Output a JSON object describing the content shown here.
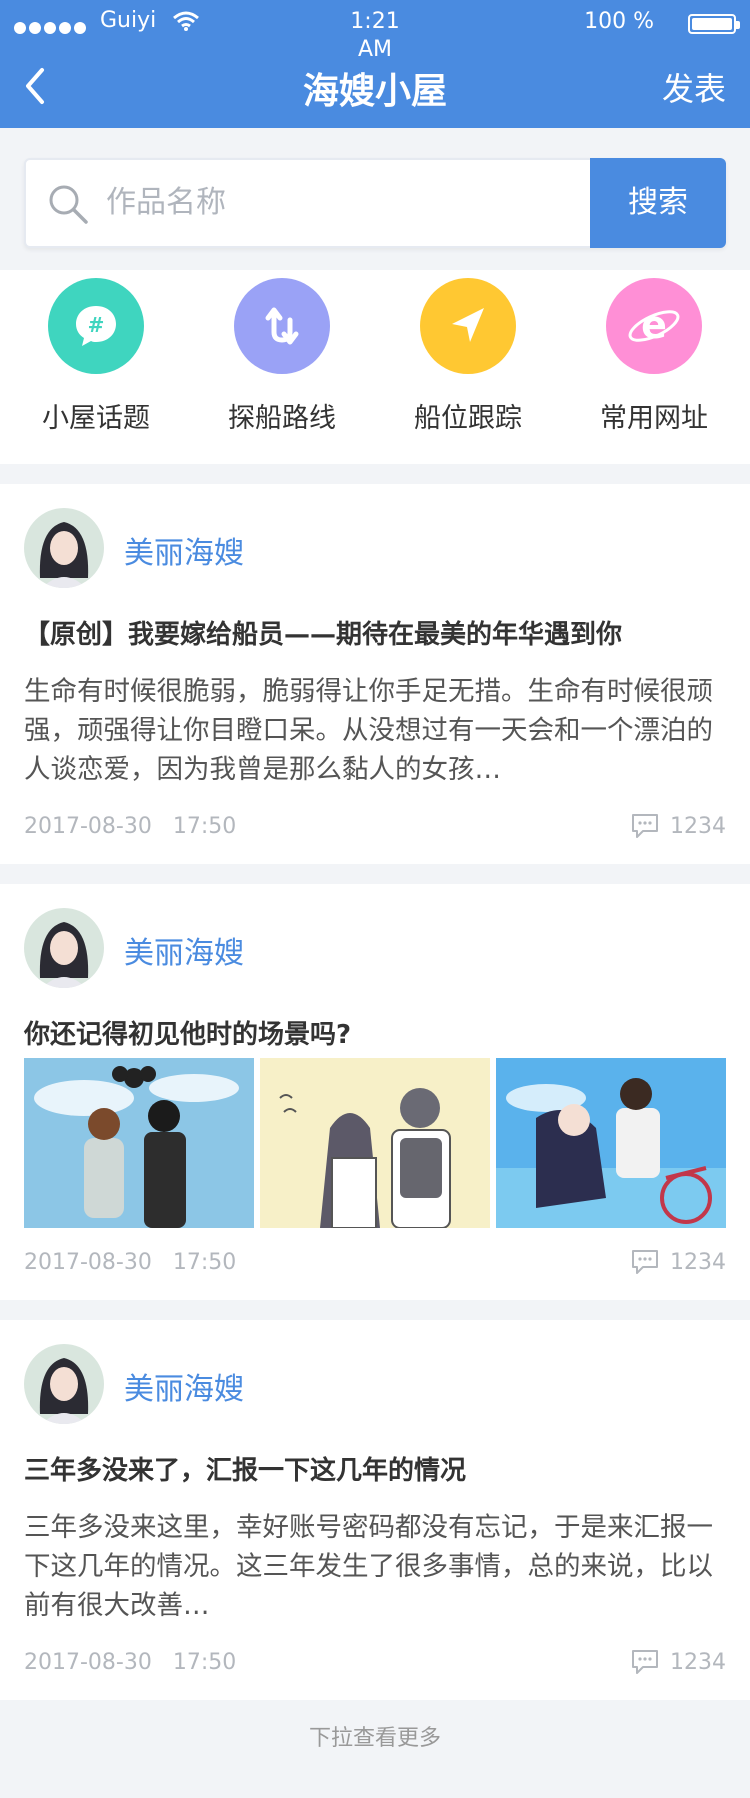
{
  "status": {
    "carrier": "Guiyi",
    "time": "1:21 AM",
    "battery": "100 %"
  },
  "nav": {
    "title": "海嫂小屋",
    "publish": "发表"
  },
  "search": {
    "placeholder": "作品名称",
    "button": "搜索"
  },
  "quick_links": [
    {
      "label": "小屋话题",
      "icon": "chat-hash-icon",
      "color": "#3fd5bf"
    },
    {
      "label": "探船路线",
      "icon": "route-arrows-icon",
      "color": "#9aa2f6"
    },
    {
      "label": "船位跟踪",
      "icon": "navigation-arrow-icon",
      "color": "#ffc832"
    },
    {
      "label": "常用网址",
      "icon": "browser-e-icon",
      "color": "#ff8fd6"
    }
  ],
  "posts": [
    {
      "author": "美丽海嫂",
      "title": "【原创】我要嫁给船员——期待在最美的年华遇到你",
      "body": "生命有时候很脆弱，脆弱得让你手足无措。生命有时候很顽强，顽强得让你目瞪口呆。从没想过有一天会和一个漂泊的人谈恋爱，因为我曾是那么黏人的女孩…",
      "date": "2017-08-30",
      "time": "17:50",
      "comments": "1234"
    },
    {
      "author": "美丽海嫂",
      "title": "你还记得初见他时的场景吗?",
      "date": "2017-08-30",
      "time": "17:50",
      "comments": "1234"
    },
    {
      "author": "美丽海嫂",
      "title": "三年多没来了，汇报一下这几年的情况",
      "body": "三年多没来这里，幸好账号密码都没有忘记，于是来汇报一下这几年的情况。这三年发生了很多事情，总的来说，比以前有很大改善…",
      "date": "2017-08-30",
      "time": "17:50",
      "comments": "1234"
    }
  ],
  "footer": {
    "more": "下拉查看更多"
  },
  "colors": {
    "brand": "#4a8be0",
    "background": "#f2f4f7"
  }
}
